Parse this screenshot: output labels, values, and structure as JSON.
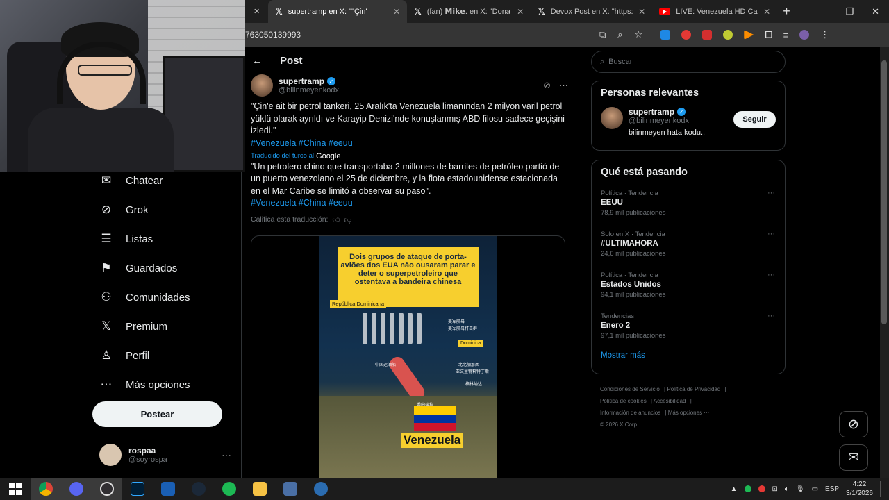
{
  "browser": {
    "tabs": [
      {
        "label": "supertramp en X: \"\"Çin'",
        "active": true,
        "icon": "x-logo"
      },
      {
        "label": "(fan) 𝗠𝗶𝗸𝗲. en X: \"Dona",
        "active": false,
        "icon": "x-logo"
      },
      {
        "label": "Devox Post en X: \"https:",
        "active": false,
        "icon": "x-logo"
      },
      {
        "label": "LIVE: Venezuela HD Cam",
        "active": false,
        "icon": "youtube-logo"
      }
    ],
    "url": "763050139993"
  },
  "nav": {
    "items": [
      {
        "label": "Chatear",
        "icon": "mail-icon"
      },
      {
        "label": "Grok",
        "icon": "grok-icon"
      },
      {
        "label": "Listas",
        "icon": "list-icon"
      },
      {
        "label": "Guardados",
        "icon": "bookmark-icon"
      },
      {
        "label": "Comunidades",
        "icon": "communities-icon"
      },
      {
        "label": "Premium",
        "icon": "x-icon"
      },
      {
        "label": "Perfil",
        "icon": "person-icon"
      },
      {
        "label": "Más opciones",
        "icon": "more-circle-icon"
      }
    ],
    "post_button": "Postear",
    "user": {
      "name": "rospaa",
      "handle": "@soyrospa"
    }
  },
  "main": {
    "header": "Post",
    "author": {
      "name": "supertramp",
      "handle": "@bilinmeyenkodx"
    },
    "original_text": "\"Çin'e ait bir petrol tankeri, 25 Aralık'ta Venezuela limanından 2 milyon varil petrol yüklü olarak ayrıldı ve Karayip Denizi'nde konuşlanmış ABD filosu sadece geçişini izledi.\"",
    "hashtags": "#Venezuela #China #eeuu",
    "translated_label": "Traducido del turco al",
    "translator": "Google",
    "translated_text": "\"Un petrolero chino que transportaba 2 millones de barriles de petróleo partió de un puerto venezolano el 25 de diciembre, y la flota estadounidense estacionada en el Mar Caribe se limitó a observar su paso\".",
    "hashtags2": "#Venezuela #China #eeuu",
    "rate_label": "Califica esta traducción:",
    "media": {
      "banner": "Dois grupos de ataque de porta-aviões dos EUA não ousaram parar e deter o superpetroleiro que ostentava a bandeira chinesa",
      "label_dr": "República Dominicana",
      "label_dm": "Dominica",
      "label_vz": "Venezuela",
      "cn1": "中国运油船",
      "cn2": "美军航母",
      "cn3": "委内瑞拉",
      "cn4": "北北加那西",
      "cn5": "亚文里特科特丁斯",
      "cn6": "格林纳达",
      "cn7": "美军航母打击群"
    }
  },
  "right": {
    "search_placeholder": "Buscar",
    "relevant_title": "Personas relevantes",
    "relevant": {
      "name": "supertramp",
      "handle": "@bilinmeyenkodx",
      "bio": "bilinmeyen hata kodu..",
      "follow": "Seguir"
    },
    "trends_title": "Qué está pasando",
    "trends": [
      {
        "meta": "Política · Tendencia",
        "name": "EEUU",
        "count": "78,9 mil publicaciones"
      },
      {
        "meta": "Solo en X · Tendencia",
        "name": "#ULTIMAHORA",
        "count": "24,6 mil publicaciones"
      },
      {
        "meta": "Política · Tendencia",
        "name": "Estados Unidos",
        "count": "94,1 mil publicaciones"
      },
      {
        "meta": "Tendencias",
        "name": "Enero 2",
        "count": "97,1 mil publicaciones"
      }
    ],
    "show_more": "Mostrar más",
    "footer": {
      "terms": "Condiciones de Servicio",
      "privacy": "Política de Privacidad",
      "cookies": "Política de cookies",
      "accessibility": "Accesibilidad",
      "ads": "Información de anuncios",
      "more": "Más opciones ···",
      "copyright": "© 2026 X Corp."
    }
  },
  "taskbar": {
    "lang": "ESP",
    "time": "4:22",
    "date": "3/1/2026"
  },
  "colors": {
    "accent": "#1d9bf0",
    "background": "#000000",
    "banner": "#f7cf2e"
  }
}
